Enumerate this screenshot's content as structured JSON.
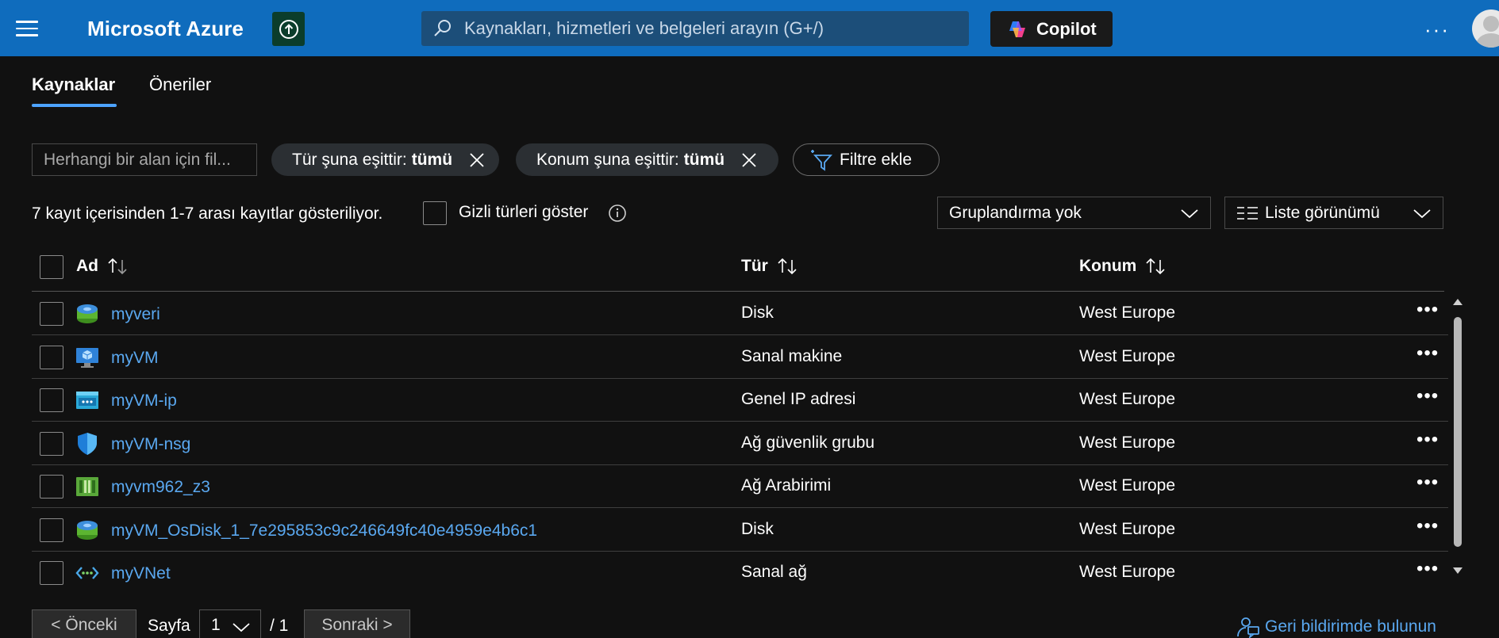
{
  "topbar": {
    "brand": "Microsoft Azure",
    "search_placeholder": "Kaynakları, hizmetleri ve belgeleri arayın (G+/)",
    "copilot_label": "Copilot",
    "more_label": "···"
  },
  "tabs": [
    {
      "label": "Kaynaklar",
      "active": true
    },
    {
      "label": "Öneriler",
      "active": false
    }
  ],
  "filters": {
    "search_placeholder": "Herhangi bir alan için fil...",
    "type_filter_prefix": "Tür şuna eşittir:",
    "type_filter_value": "tümü",
    "location_filter_prefix": "Konum şuna eşittir:",
    "location_filter_value": "tümü",
    "add_filter_label": "Filtre ekle"
  },
  "toolbar": {
    "record_count": "7 kayıt içerisinden 1-7 arası kayıtlar gösteriliyor.",
    "show_hidden_types": "Gizli türleri göster",
    "grouping": "Gruplandırma yok",
    "view": "Liste görünümü"
  },
  "table": {
    "columns": [
      "Ad",
      "Tür",
      "Konum"
    ],
    "rows": [
      {
        "name": "myveri",
        "type": "Disk",
        "location": "West Europe",
        "icon": "disk-icon"
      },
      {
        "name": "myVM",
        "type": "Sanal makine",
        "location": "West Europe",
        "icon": "virtual-machine-icon"
      },
      {
        "name": "myVM-ip",
        "type": "Genel IP adresi",
        "location": "West Europe",
        "icon": "public-ip-icon"
      },
      {
        "name": "myVM-nsg",
        "type": "Ağ güvenlik grubu",
        "location": "West Europe",
        "icon": "shield-icon"
      },
      {
        "name": "myvm962_z3",
        "type": "Ağ Arabirimi",
        "location": "West Europe",
        "icon": "network-interface-icon"
      },
      {
        "name": "myVM_OsDisk_1_7e295853c9c246649fc40e4959e4b6c1",
        "type": "Disk",
        "location": "West Europe",
        "icon": "disk-icon"
      },
      {
        "name": "myVNet",
        "type": "Sanal ağ",
        "location": "West Europe",
        "icon": "virtual-network-icon"
      }
    ],
    "row_more": "•••"
  },
  "pagination": {
    "prev_label": "< Önceki",
    "page_label": "Sayfa",
    "current_page": "1",
    "total_pages": "/ 1",
    "next_label": "Sonraki >"
  },
  "feedback_label": "Geri bildirimde bulunun",
  "colors": {
    "topbar": "#0f6cbd",
    "background": "#111111",
    "link": "#5aa8f0",
    "accent": "#4da3ff"
  }
}
